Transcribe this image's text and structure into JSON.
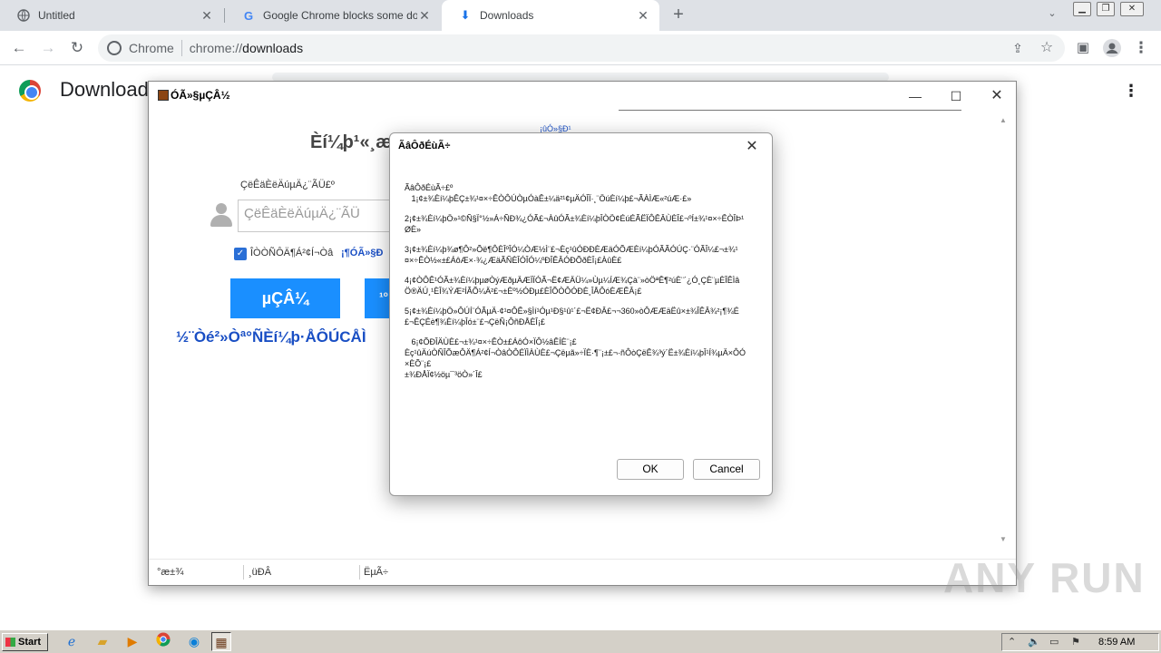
{
  "browser": {
    "tabs": [
      {
        "label": "Untitled",
        "active": false
      },
      {
        "label": "Google Chrome blocks some downlo",
        "active": false
      },
      {
        "label": "Downloads",
        "active": true
      }
    ],
    "omnibox": {
      "chip": "Chrome",
      "url_scheme": "chrome://",
      "url_host": "downloads"
    }
  },
  "downloads_page": {
    "title": "Download"
  },
  "installer": {
    "window_title": "ÓÃ»§µÇÂ½",
    "heading": "Èí¼þ¹«¸æ",
    "top_link": "¡ûÓ»§Ð¹",
    "field_label": "ÇëÊäÈëÄúµÄ¿¨ÃÜ£º",
    "input_placeholder": "ÇëÊäÈëÄúµÄ¿¨ÃÜ",
    "check_label": "ÎÒÒÑÔÄ¶Á²¢Í¬Òâ",
    "check_link": "¡¶ÓÃ»§Ð­",
    "main_button": "µÇÂ¼",
    "second_button": "¹º",
    "bottom_text": "½¨Òé²»Òª°ÑÈí¼þ·ÅÔÚCÅÌ",
    "status_cells": [
      "°æ±¾",
      "¸üÐÂ",
      "ËµÃ÷"
    ]
  },
  "dialog": {
    "title": "ÃâÔðÉùÃ÷",
    "paragraphs": [
      "ÃâÔðÉùÃ÷£º\n   1¡¢±¾Èí¼þÊÇ±¾¹¤×÷ÊÒÔÚÒµÓàÊ±¼ä²¹¢µÄÓÎÏ·¸¨ÖúÈí¼þ£¬ÃÀÌÆ«²úÆ·£»",
      "2¡¢±¾Èí¼þÖ»¹©Ñ§Ï°½»Á÷ÑÐ¾¿ÓÃ£¬ÀûÓÃ±¾Èí¼þÎÒÖ¢ÉúÉÃËÏÔÊÂÙÈÎ£¬ºÍ±¾¹¤×÷ÊÒÎÞ¹ØÈ»",
      "3¡¢±¾Èí¼þ¾ø¶Ô²»Õë¶ÔÈÎºÎÓ¼ÒÆ½Ì¨£¬Èç¹ûÓÐÐÈÆäÓÕÆÈí¼þÓÃÃÓÚÇ·¨ÓÃÎ¼£¬±¾¹¤×÷ÊÒ½«±£ÁôÆ×·¾¿ÆäÃÑÈÎÓÎÓ¼ºÐÎÊÂÓÐÕðÈÎ¡£ÀûÈ£",
      "4¡¢ÒÔÊ¹ÓÃ±¾Èí¼þµøÒýÆðµÄÆÏÏÓÃ¬Ë¢ÆÄÜ¼»Ùµ¼ÍÆ¾Çà¨»òÖªÊ¶²úÈ¨´¿Ó¸ÇÈ¨µÈÎÊÌâÖ®ÄÚ¸¹ÈÎ¾ÝÆ²ÍÃÕ¼Ä²£¬±Èº½ÓÐµ£ÈÎÕÒÔÓÐÈ¸ÎÅÔóÈÆÊÂ¡£",
      "5¡¢±¾Èí¼þÖ»ÔÚÍ¨ÓÃµÄ·¢¹¤ÔÊ»§Ìí¹Óµ¹Ð§¹û¹´£¬Ë¢ÐÂ£¬¬360»òÔÆÆäËû×±¾ÎÊÂ¾²¡¶¾É£¬ÊÇÉè¶¾Èí¼þÎó±¨£¬ÇëÑ¡ÔñÐÅÈÎ¡£",
      "   6¡¢ÕÐÎÄÙÈ£¬±¾¹¤×÷ÊÒ±£ÁôÓ×ÏÔ½âÊÍÈ¨¡£\nÈç¹ûÄúÒÑÎÕæÔÄ¶Á²¢Í¬ÒâÒÔÉÏÌÀÙÈ£¬Çëµã»÷ÏÈ·¶¨¡±£¬·ñÔòÇëÊ¾³ý´Ë±¾Èí¼þÎ¹Í¾µÄ×ÔÓ×ÈÕ¨¡£\n±¾ÐÅÏ¢½öµ¯³öÒ»´Î£"
    ],
    "ok_label": "OK",
    "cancel_label": "Cancel"
  },
  "taskbar": {
    "start_label": "Start",
    "clock": "8:59 AM"
  },
  "watermark": "ANY RUN"
}
